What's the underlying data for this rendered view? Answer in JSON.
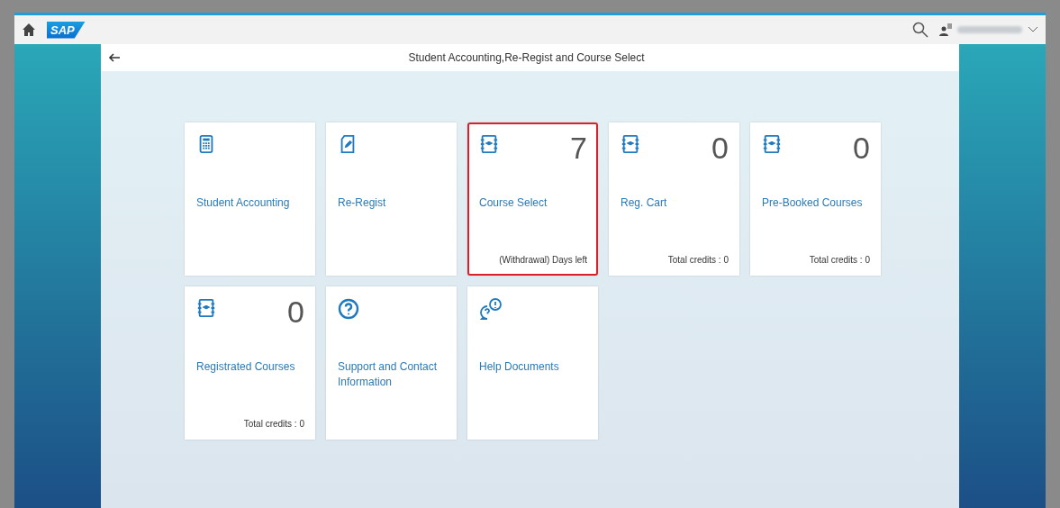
{
  "shell": {
    "logo": "SAP"
  },
  "page": {
    "title": "Student Accounting,Re-Regist and Course Select"
  },
  "tiles": [
    {
      "kind": "calculator",
      "title": "Student Accounting",
      "highlighted": false
    },
    {
      "kind": "document",
      "title": "Re-Regist",
      "highlighted": false
    },
    {
      "kind": "notebook",
      "count": "7",
      "title": "Course Select",
      "footer": "(Withdrawal) Days left",
      "highlighted": true
    },
    {
      "kind": "notebook",
      "count": "0",
      "title": "Reg. Cart",
      "footer": "Total credits : 0",
      "highlighted": false
    },
    {
      "kind": "notebook",
      "count": "0",
      "title": "Pre-Booked Courses",
      "footer": "Total credits : 0",
      "highlighted": false
    },
    {
      "kind": "notebook",
      "count": "0",
      "title": "Registrated Courses",
      "footer": "Total credits : 0",
      "highlighted": false
    },
    {
      "kind": "question",
      "title": "Support and Contact Information",
      "highlighted": false
    },
    {
      "kind": "bubbles",
      "title": "Help Documents",
      "highlighted": false
    }
  ]
}
